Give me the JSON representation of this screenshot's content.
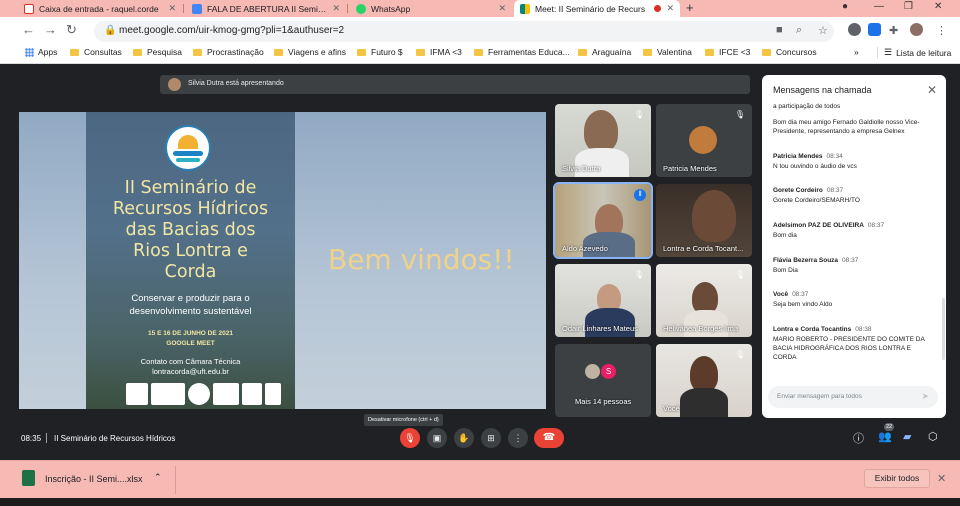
{
  "browser": {
    "tabs": [
      {
        "title": "Caixa de entrada - raquel.corde",
        "icon_color": "#d93025",
        "icon": "gmail-icon"
      },
      {
        "title": "FALA DE ABERTURA II Seminário",
        "icon_color": "#4285f4",
        "icon": "docs-icon"
      },
      {
        "title": "WhatsApp",
        "icon_color": "#25d366",
        "icon": "whatsapp-icon"
      },
      {
        "title": "Meet: II Seminário de Recurs",
        "icon_color": "#00897b",
        "icon": "meet-icon"
      }
    ],
    "new_tab": "+",
    "url": "meet.google.com/uir-kmog-gmg?pli=1&authuser=2",
    "bookmarks": [
      "Apps",
      "Consultas",
      "Pesquisa",
      "Procrastinação",
      "Viagens e afins",
      "Futuro $",
      "IFMA <3",
      "Ferramentas Educa...",
      "Araguaína",
      "Valentina",
      "IFCE <3",
      "Concursos"
    ],
    "reading_list": "Lista de leitura",
    "more_bookmarks": "»"
  },
  "meet": {
    "presenting_banner": "Silvia Dutra está apresentando",
    "slide": {
      "title_lines": [
        "II Seminário de",
        "Recursos Hídricos",
        "das Bacias dos",
        "Rios Lontra e",
        "Corda"
      ],
      "subtitle_lines": [
        "Conservar e produzir para o",
        "desenvolvimento sustentável"
      ],
      "date": "15 E 16 DE JUNHO DE 2021",
      "platform": "GOOGLE MEET",
      "contact_lines": [
        "Contato com Câmara Técnica",
        "lontracorda@uft.edu.br"
      ],
      "welcome": "Bem vindos!!"
    },
    "participants": [
      {
        "name": "Silvia Dutra"
      },
      {
        "name": "Patricia Mendes"
      },
      {
        "name": "Aldo Azevedo"
      },
      {
        "name": "Lontra e Corda Tocant..."
      },
      {
        "name": "Odair Linhares Mateus"
      },
      {
        "name": "Helivânea Borges lima"
      },
      {
        "name": "Mais 14 pessoas"
      },
      {
        "name": "Você"
      }
    ],
    "more_people_initial": "S",
    "time": "08:35",
    "meeting_title": "II Seminário de Recursos Hídricos",
    "mic_tooltip": "Desativar microfone (ctrl + d)",
    "people_count": "22",
    "accent": "#1a73e8",
    "danger": "#ea4335"
  },
  "chat": {
    "header": "Mensagens na chamada",
    "messages": [
      {
        "sender": "",
        "time": "",
        "text": "a participação de todos"
      },
      {
        "sender": "",
        "time": "",
        "text": "Bom dia meu amigo Fernado Galdiolle nosso Vice-Presidente, representando a empresa Gelnex"
      },
      {
        "sender": "Patricia Mendes",
        "time": "08:34",
        "text": "N tou ouvindo o áudio de vcs"
      },
      {
        "sender": "Gorete Cordeiro",
        "time": "08:37",
        "text": "Gorete Cordeiro/SEMARH/TO"
      },
      {
        "sender": "Adelsimon PAZ DE OLIVEIRA",
        "time": "08:37",
        "text": "Bom dia"
      },
      {
        "sender": "Flávia Bezerra Souza",
        "time": "08:37",
        "text": "Bom Dia"
      },
      {
        "sender": "Você",
        "time": "08:37",
        "text": "Seja bem vindo Aldo"
      },
      {
        "sender": "Lontra e Corda Tocantins",
        "time": "08:38",
        "text": "MARIO ROBERTO - PRESIDENTE DO COMITE DA BACIA HIDROGRÁFICA DOS RIOS LONTRA E CORDA"
      }
    ],
    "input_placeholder": "Enviar mensagem para todos"
  },
  "downloads": {
    "file": "Inscrição - II Semi....xlsx",
    "show_all": "Exibir todos"
  }
}
